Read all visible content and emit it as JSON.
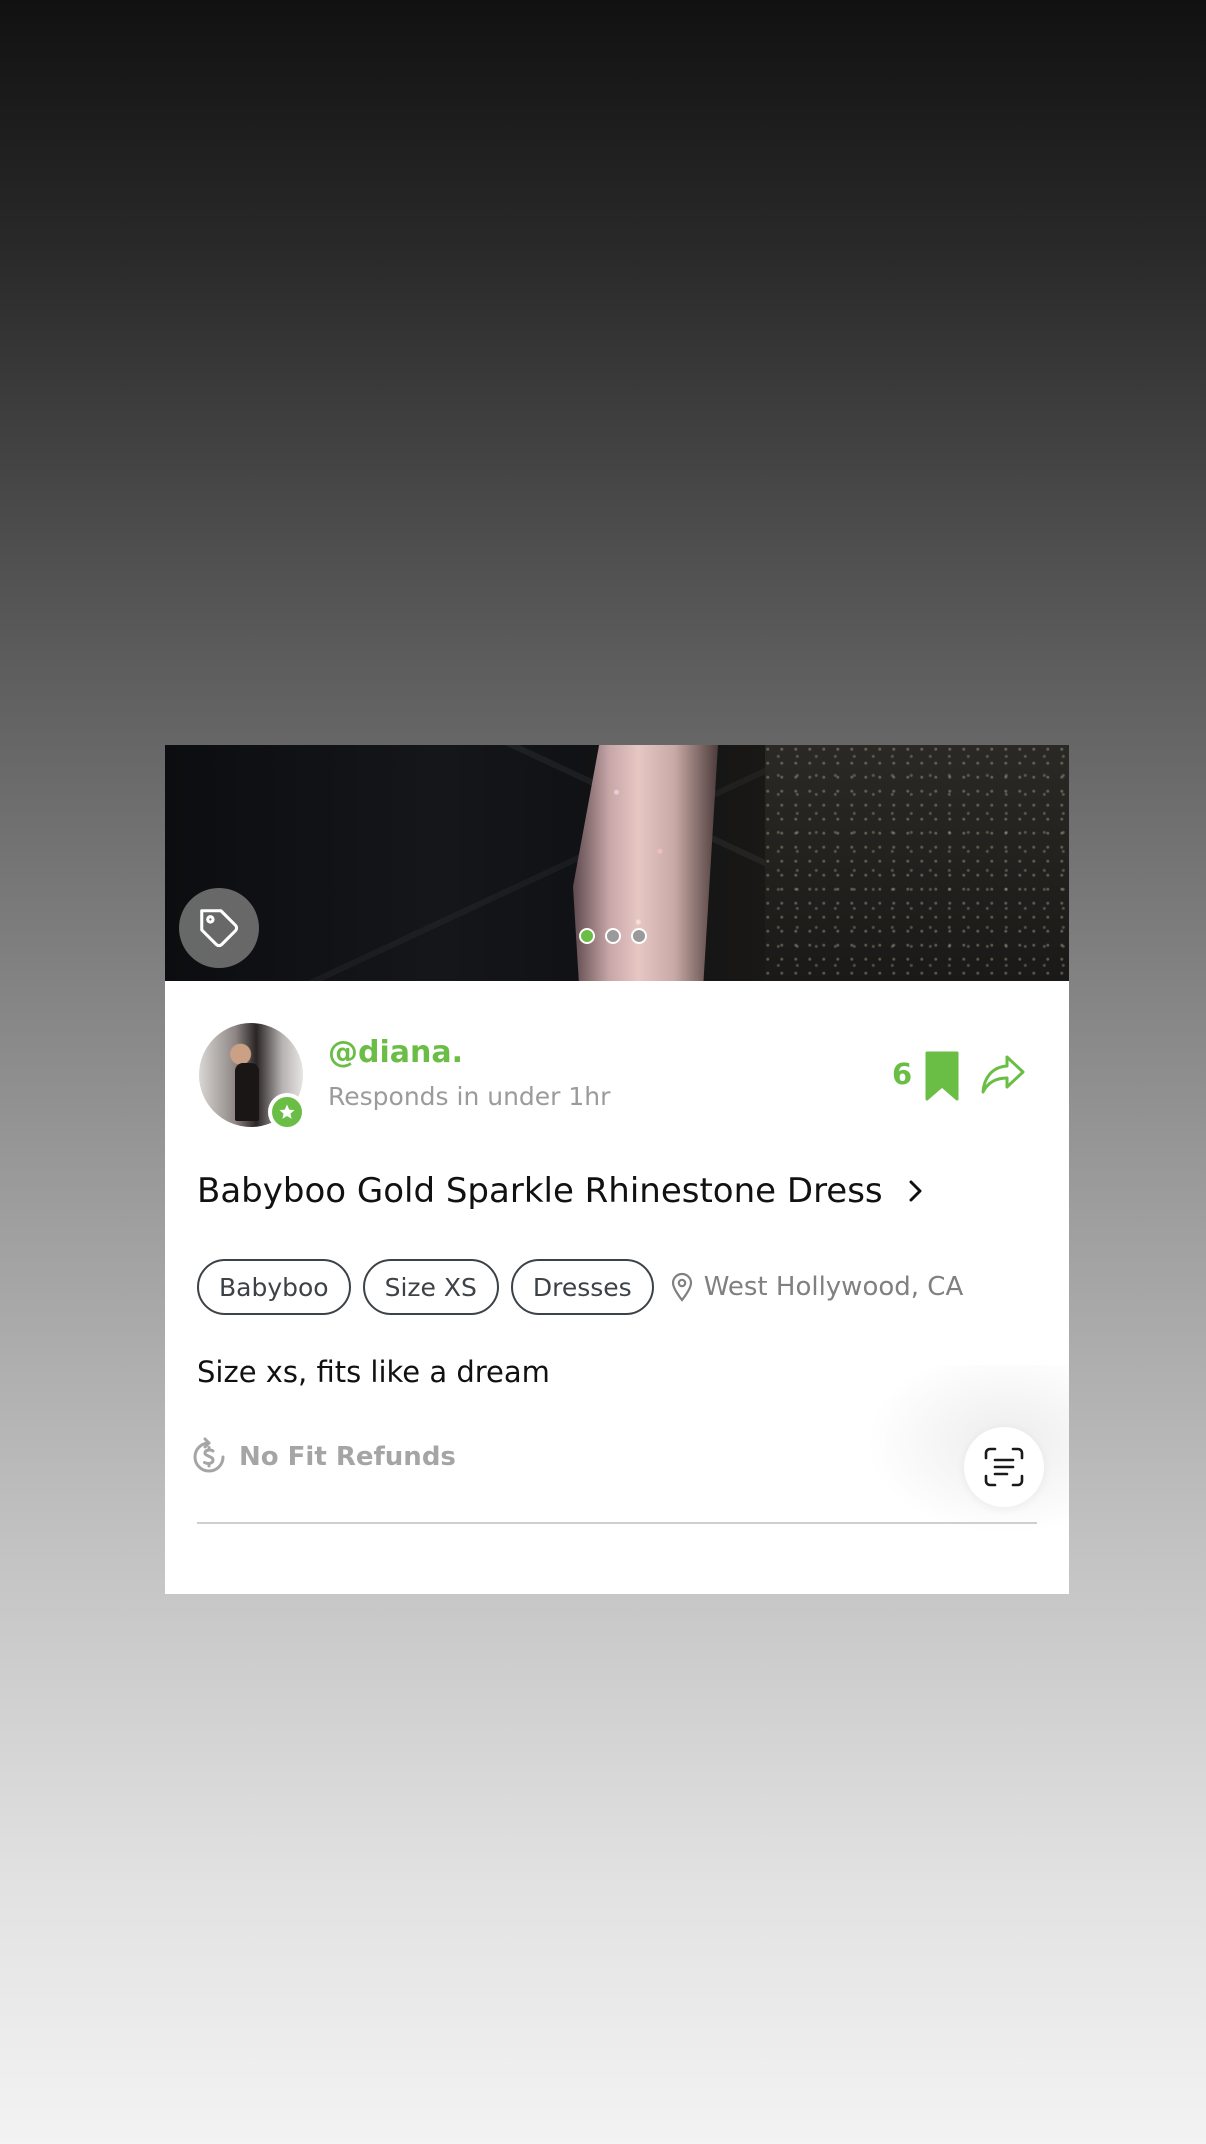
{
  "listing": {
    "photo_count": 3,
    "active_photo": 1,
    "seller": {
      "username": "@diana.",
      "responds": "Responds in under 1hr"
    },
    "save_count": "6",
    "title": "Babyboo Gold Sparkle Rhinestone Dress",
    "tags": [
      "Babyboo",
      "Size XS",
      "Dresses"
    ],
    "location": "West Hollywood, CA",
    "description": "Size xs, fits like a dream",
    "refund_policy": "No Fit Refunds"
  },
  "icons": {
    "tag": "tag-icon",
    "verified_badge": "star-badge-icon",
    "bookmark": "bookmark-icon",
    "share": "share-icon",
    "chevron": "chevron-right-icon",
    "location": "location-pin-icon",
    "refund": "dollar-refund-icon",
    "scan": "scan-text-icon"
  },
  "colors": {
    "accent": "#6bbe45",
    "text": "#111111",
    "muted": "#9b9b9b",
    "pill_border": "#3d4247"
  }
}
